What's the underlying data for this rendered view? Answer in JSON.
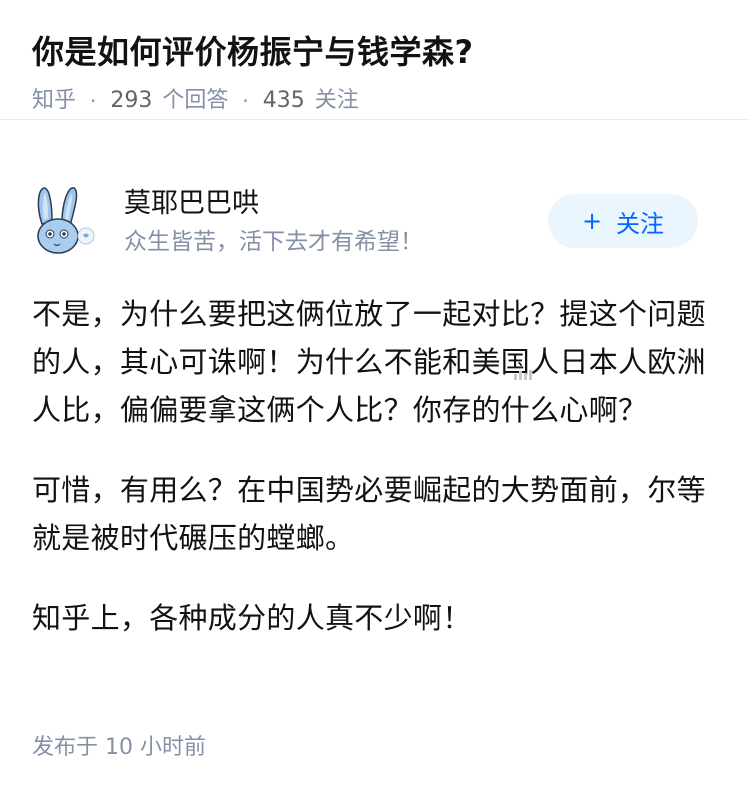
{
  "question": {
    "title": "你是如何评价杨振宁与钱学森?",
    "source": "知乎",
    "answers_count": "293",
    "answers_label": "个回答",
    "followers_count": "435",
    "followers_label": "关注"
  },
  "author": {
    "name": "莫耶巴巴哄",
    "signature": "众生皆苦，活下去才有希望！",
    "follow_label": "关注",
    "follow_icon": "plus-icon",
    "avatar_icon": "bunny-avatar"
  },
  "answer": {
    "paragraphs": [
      "不是，为什么要把这俩位放了一起对比？提这个问题的人，其心可诛啊！为什么不能和美国人日本人欧洲人比，偏偏要拿这俩个人比？你存的什么心啊？",
      "可惜，有用么？在中国势必要崛起的大势面前，尔等就是被时代碾压的螳螂。",
      "知乎上，各种成分的人真不少啊！"
    ]
  },
  "footer": {
    "published": "发布于  10 小时前"
  },
  "colors": {
    "accent": "#0066ff",
    "follow_bg": "#ebf5fd",
    "meta": "#8590a6",
    "text": "#121212"
  }
}
